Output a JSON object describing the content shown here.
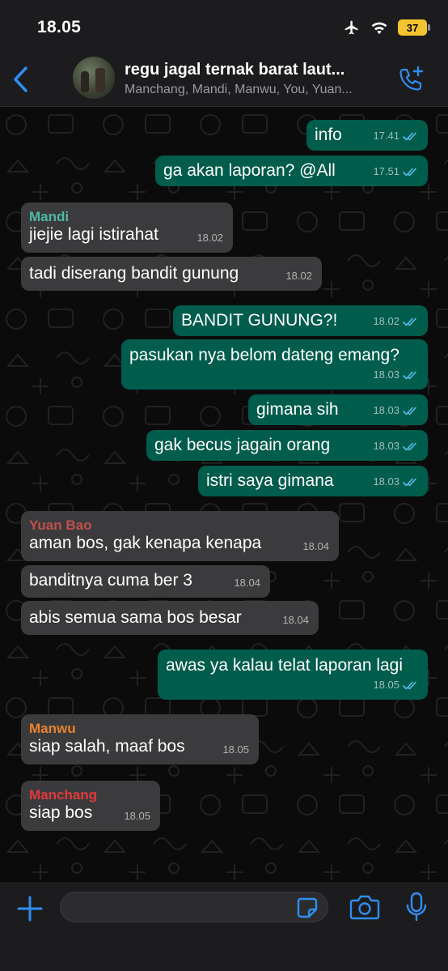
{
  "status_bar": {
    "time": "18.05",
    "battery": "37"
  },
  "header": {
    "title": "regu jagal ternak barat laut...",
    "members": "Manchang, Mandi, Manwu, You, Yuan..."
  },
  "messages": [
    {
      "dir": "out",
      "text": "info",
      "time": "17.41",
      "read": true
    },
    {
      "dir": "out",
      "text": "ga akan laporan? @All",
      "time": "17.51",
      "read": true
    },
    {
      "dir": "in",
      "sender": "Mandi",
      "sender_color": "#4fb8a4",
      "text": "jiejie lagi istirahat",
      "time": "18.02"
    },
    {
      "dir": "in",
      "text": "tadi diserang bandit gunung",
      "time": "18.02"
    },
    {
      "dir": "out",
      "text": "BANDIT GUNUNG?!",
      "time": "18.02",
      "read": true
    },
    {
      "dir": "out",
      "text": "pasukan nya belom dateng emang?",
      "time": "18.03",
      "read": true
    },
    {
      "dir": "out",
      "text": "gimana sih",
      "time": "18.03",
      "read": true
    },
    {
      "dir": "out",
      "text": "gak becus jagain orang",
      "time": "18.03",
      "read": true
    },
    {
      "dir": "out",
      "text": "istri saya gimana",
      "time": "18.03",
      "read": true
    },
    {
      "dir": "in",
      "sender": "Yuan Bao",
      "sender_color": "#c0504d",
      "text": "aman bos, gak kenapa kenapa",
      "time": "18.04"
    },
    {
      "dir": "in",
      "text": "banditnya cuma ber 3",
      "time": "18.04"
    },
    {
      "dir": "in",
      "text": "abis semua sama bos besar",
      "time": "18.04"
    },
    {
      "dir": "out",
      "text": "awas ya kalau telat laporan lagi",
      "time": "18.05",
      "read": true
    },
    {
      "dir": "in",
      "sender": "Manwu",
      "sender_color": "#e8832e",
      "text": "siap salah, maaf bos",
      "time": "18.05"
    },
    {
      "dir": "in",
      "sender": "Manchang",
      "sender_color": "#e03a3a",
      "text": "siap bos",
      "time": "18.05"
    }
  ],
  "input": {
    "placeholder": ""
  },
  "icons": {
    "back": "chevron-left-icon",
    "add_call": "phone-plus-icon",
    "plus": "plus-icon",
    "sticker": "sticker-icon",
    "camera": "camera-icon",
    "mic": "microphone-icon"
  },
  "colors": {
    "accent": "#2f8ef0",
    "outgoing_bubble": "#005c4b",
    "incoming_bubble": "#3b3b3d",
    "read_tick": "#53bdeb"
  }
}
